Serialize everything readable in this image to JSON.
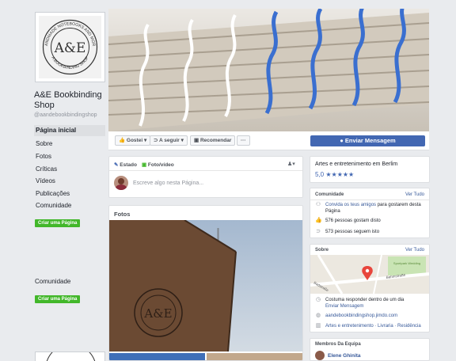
{
  "logo": {
    "center": "A&E",
    "ring_top": "HANDMADE NOTEBOOKS AND MORE",
    "ring_bottom": "A BOOKBINDING SHOP"
  },
  "page": {
    "name": "A&E Bookbinding Shop",
    "handle": "@aandebookbindingshop"
  },
  "nav": [
    "Página inicial",
    "Sobre",
    "Fotos",
    "Críticas",
    "Vídeos",
    "Publicações",
    "Comunidade"
  ],
  "create_page_label": "Criar uma Página",
  "community_label": "Comunidade",
  "actions": {
    "like": "Gostei",
    "follow": "A seguir",
    "recommend": "Recomendar",
    "more": "···",
    "message": "Enviar Mensagem"
  },
  "composer": {
    "status": "Estado",
    "photo": "Foto/vídeo",
    "placeholder": "Escreve algo nesta Página..."
  },
  "photos": {
    "title": "Fotos"
  },
  "info": {
    "category": "Artes e entretenimento em Berlim",
    "rating": "5,0",
    "stars": "★★★★★"
  },
  "community": {
    "title": "Comunidade",
    "see_all": "Ver Tudo",
    "invite_link": "Convida os teus amigos",
    "invite_rest": " para gostarem desta Página",
    "likes": "576 pessoas gostam disto",
    "follows": "573 pessoas seguem isto"
  },
  "about": {
    "title": "Sobre",
    "see_all": "Ver Tudo",
    "map_label": "Sportpark Wedding",
    "map_street1": "Badstraße",
    "map_street2": "Behmstraße",
    "response": "Costuma responder dentro de um dia",
    "send_message": "Enviar Mensagem",
    "website": "aandebookbindingshop.jimdo.com",
    "categories": "Artes e entretenimento · Livraria · Residência"
  },
  "team": {
    "title": "Membros Da Equipa",
    "member": "Elene Ghinita"
  },
  "colors": {
    "brand_blue": "#4267b2",
    "link": "#365899",
    "green": "#42b72a",
    "thread_blue": "#3a6fd0"
  }
}
